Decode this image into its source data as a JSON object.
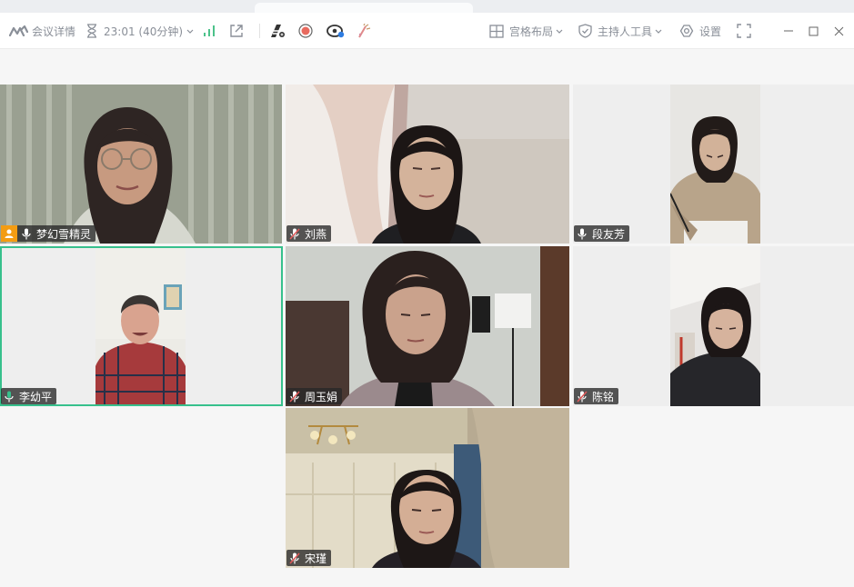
{
  "toolbar": {
    "meeting_details": "会议详情",
    "timer": "23:01 (40分钟)",
    "layout": "宫格布局",
    "host_tools": "主持人工具",
    "settings": "设置"
  },
  "participants": [
    {
      "name": "梦幻雪精灵",
      "host": true,
      "mic": "on",
      "speaking": false
    },
    {
      "name": "刘燕",
      "host": false,
      "mic": "muted",
      "speaking": false
    },
    {
      "name": "段友芳",
      "host": false,
      "mic": "on",
      "speaking": false
    },
    {
      "name": "李幼平",
      "host": false,
      "mic": "speaking",
      "speaking": true
    },
    {
      "name": "周玉娟",
      "host": false,
      "mic": "muted",
      "speaking": false
    },
    {
      "name": "陈铭",
      "host": false,
      "mic": "muted",
      "speaking": false
    },
    {
      "name": "宋瑾",
      "host": false,
      "mic": "muted",
      "speaking": false
    }
  ],
  "colors": {
    "active_border": "#37c08c",
    "host_badge": "#f39c12",
    "muted_mic": "#e05a5a",
    "signal": "#4cc28a"
  }
}
